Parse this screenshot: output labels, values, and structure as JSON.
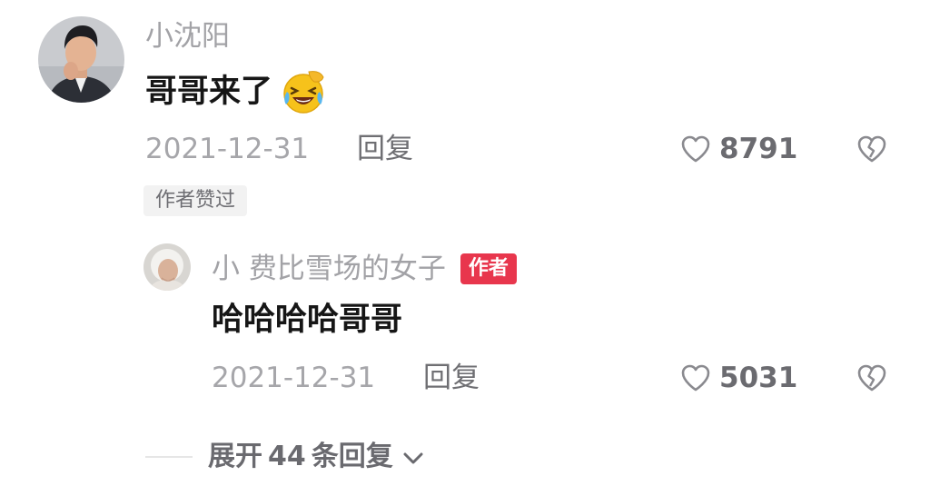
{
  "comment": {
    "username": "小沈阳",
    "text": "哥哥来了",
    "emoji": "laughing-crying-emoji",
    "date": "2021-12-31",
    "reply_label": "回复",
    "likes": "8791",
    "author_liked_label": "作者赞过"
  },
  "reply": {
    "username": "小 费比雪场的女子",
    "author_badge": "作者",
    "text": "哈哈哈哈哥哥",
    "date": "2021-12-31",
    "reply_label": "回复",
    "likes": "5031"
  },
  "expand": {
    "prefix": "展开",
    "count": "44",
    "suffix": "条回复"
  },
  "colors": {
    "accent_badge": "#e8364d",
    "text_primary": "#161616",
    "text_secondary": "#a2a2a6"
  }
}
